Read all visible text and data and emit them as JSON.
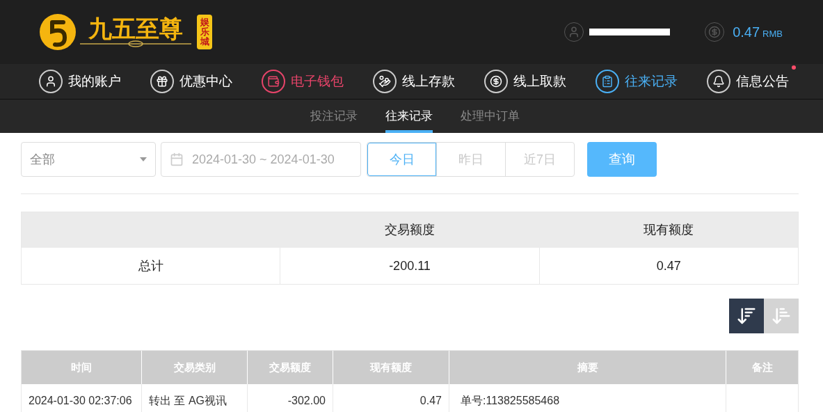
{
  "brand": {
    "name": "九五至尊",
    "badge": "娱乐城"
  },
  "account": {
    "balance": "0.47",
    "currency": "RMB"
  },
  "nav": [
    {
      "label": "我的账户",
      "color": "#ffffff",
      "badge": false
    },
    {
      "label": "优惠中心",
      "color": "#ffffff",
      "badge": false
    },
    {
      "label": "电子钱包",
      "color": "#e8446a",
      "badge": false
    },
    {
      "label": "线上存款",
      "color": "#ffffff",
      "badge": false
    },
    {
      "label": "线上取款",
      "color": "#ffffff",
      "badge": false
    },
    {
      "label": "往来记录",
      "color": "#4ab0f5",
      "badge": false
    },
    {
      "label": "信息公告",
      "color": "#ffffff",
      "badge": true
    }
  ],
  "subtabs": [
    {
      "label": "投注记录",
      "selected": false
    },
    {
      "label": "往来记录",
      "selected": true
    },
    {
      "label": "处理中订单",
      "selected": false
    }
  ],
  "filter": {
    "type": "全部",
    "date_range": "2024-01-30 ~ 2024-01-30",
    "presets": [
      {
        "label": "今日",
        "selected": true
      },
      {
        "label": "昨日",
        "selected": false
      },
      {
        "label": "近7日",
        "selected": false
      }
    ],
    "search_button": "查询"
  },
  "summary": {
    "columns": [
      "",
      "交易额度",
      "现有额度"
    ],
    "rows": [
      [
        "总计",
        "-200.11",
        "0.47"
      ]
    ]
  },
  "sort": [
    {
      "selected": true
    },
    {
      "selected": false
    }
  ],
  "table": {
    "columns": [
      "时间",
      "交易类别",
      "交易额度",
      "现有额度",
      "摘要",
      "备注"
    ],
    "rows": [
      [
        "2024-01-30 02:37:06",
        "转出 至 AG视讯",
        "-302.00",
        "0.47",
        "单号:113825585468",
        ""
      ]
    ]
  }
}
